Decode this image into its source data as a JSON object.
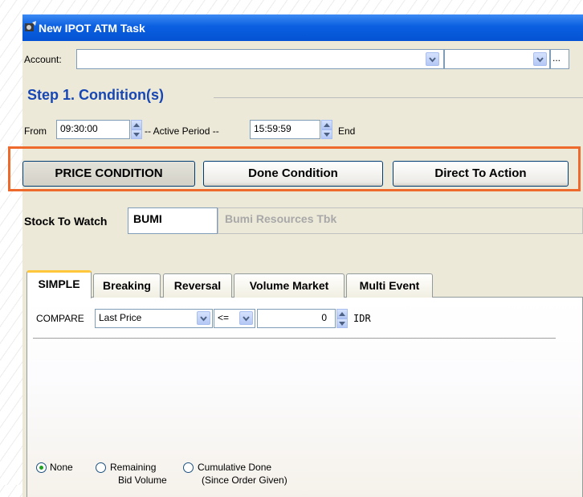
{
  "window": {
    "title": "New IPOT ATM Task"
  },
  "account": {
    "label": "Account:",
    "value": "",
    "secondary_value": "",
    "browse_label": "..."
  },
  "step": {
    "title": "Step 1. Condition(s)"
  },
  "period": {
    "from_label": "From",
    "from_value": "09:30:00",
    "active_label": "-- Active Period --",
    "end_value": "15:59:59",
    "end_label": "End"
  },
  "condition_buttons": [
    {
      "label": "PRICE CONDITION",
      "active": true
    },
    {
      "label": "Done Condition",
      "active": false
    },
    {
      "label": "Direct To Action",
      "active": false
    }
  ],
  "stock": {
    "label": "Stock To Watch",
    "code": "BUMI",
    "name": "Bumi Resources Tbk"
  },
  "tabs": [
    {
      "label": "SIMPLE",
      "active": true
    },
    {
      "label": "Breaking",
      "active": false
    },
    {
      "label": "Reversal",
      "active": false
    },
    {
      "label": "Volume Market",
      "active": false
    },
    {
      "label": "Multi Event",
      "active": false
    }
  ],
  "compare": {
    "label": "COMPARE",
    "field": "Last Price",
    "operator": "<=",
    "value": "0",
    "unit": "IDR"
  },
  "volume_options": [
    {
      "line1": "None",
      "line2": "",
      "checked": true
    },
    {
      "line1": "Remaining",
      "line2": "Bid Volume",
      "checked": false
    },
    {
      "line1": "Cumulative Done",
      "line2": "(Since Order Given)",
      "checked": false
    }
  ],
  "colors": {
    "highlight": "#ee6a2c",
    "step_title": "#1747b4",
    "titlebar": "#0a5fe0"
  }
}
